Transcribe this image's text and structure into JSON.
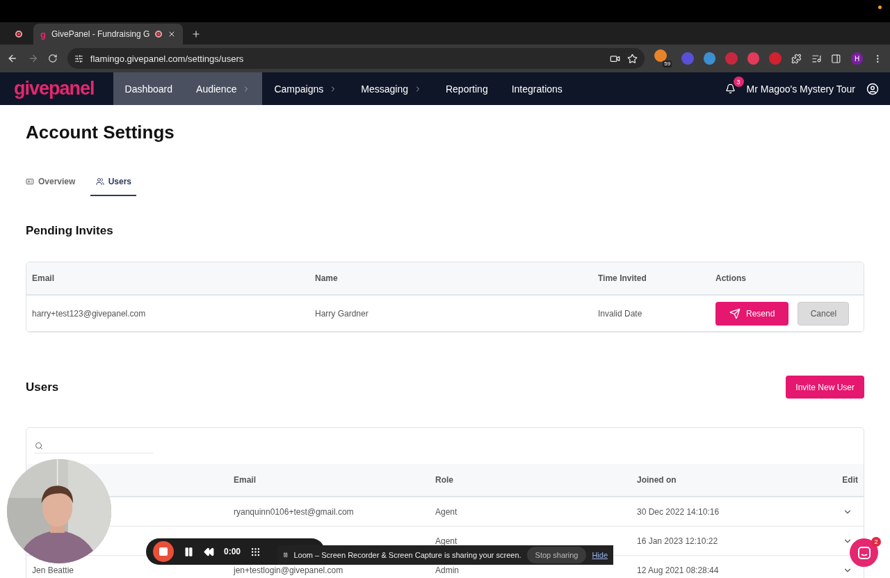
{
  "browser": {
    "tabs": [
      {
        "kind": "recording",
        "selected": false
      },
      {
        "title": "GivePanel - Fundraising G",
        "favicon": "g",
        "kind": "page",
        "selected": true
      }
    ],
    "url": "flamingo.givepanel.com/settings/users",
    "extension_badge": "59",
    "profile_initial": "H"
  },
  "nav": {
    "logo": "givepanel",
    "items": [
      {
        "label": "Dashboard",
        "highlighted": true,
        "submenu": false
      },
      {
        "label": "Audience",
        "highlighted": true,
        "submenu": true
      },
      {
        "label": "Campaigns",
        "highlighted": false,
        "submenu": true
      },
      {
        "label": "Messaging",
        "highlighted": false,
        "submenu": true
      },
      {
        "label": "Reporting",
        "highlighted": false,
        "submenu": false
      },
      {
        "label": "Integrations",
        "highlighted": false,
        "submenu": false
      }
    ],
    "notification_count": "3",
    "account": "Mr Magoo's Mystery Tour"
  },
  "page_title": "Account Settings",
  "tabs": [
    {
      "label": "Overview",
      "kind": "overview",
      "selected": false
    },
    {
      "label": "Users",
      "kind": "users",
      "selected": true
    }
  ],
  "pending": {
    "title": "Pending Invites",
    "columns": [
      "Email",
      "Name",
      "Time Invited",
      "Actions"
    ],
    "rows": [
      {
        "email": "harry+test123@givepanel.com",
        "name": "Harry Gardner",
        "time": "Invalid Date",
        "resend": "Resend",
        "cancel": "Cancel"
      }
    ]
  },
  "users": {
    "title": "Users",
    "invite_button": "Invite New User",
    "columns": [
      "Email",
      "Role",
      "Joined on",
      "Edit"
    ],
    "rows": [
      {
        "email": "ryanquinn0106+test@gmail.com",
        "role": "Agent",
        "joined": "30 Dec 2022 14:10:16"
      },
      {
        "role": "Agent",
        "joined": "16 Jan 2023 12:10:22"
      },
      {
        "name": "Jen Beattie",
        "email": "jen+testlogin@givepanel.com",
        "role": "Admin",
        "joined": "12 Aug 2021 08:28:44"
      }
    ]
  },
  "recorder": {
    "time": "0:00",
    "message": "Loom – Screen Recorder & Screen Capture is sharing your screen.",
    "stop": "Stop sharing",
    "hide": "Hide"
  },
  "chat": {
    "badge": "2"
  }
}
